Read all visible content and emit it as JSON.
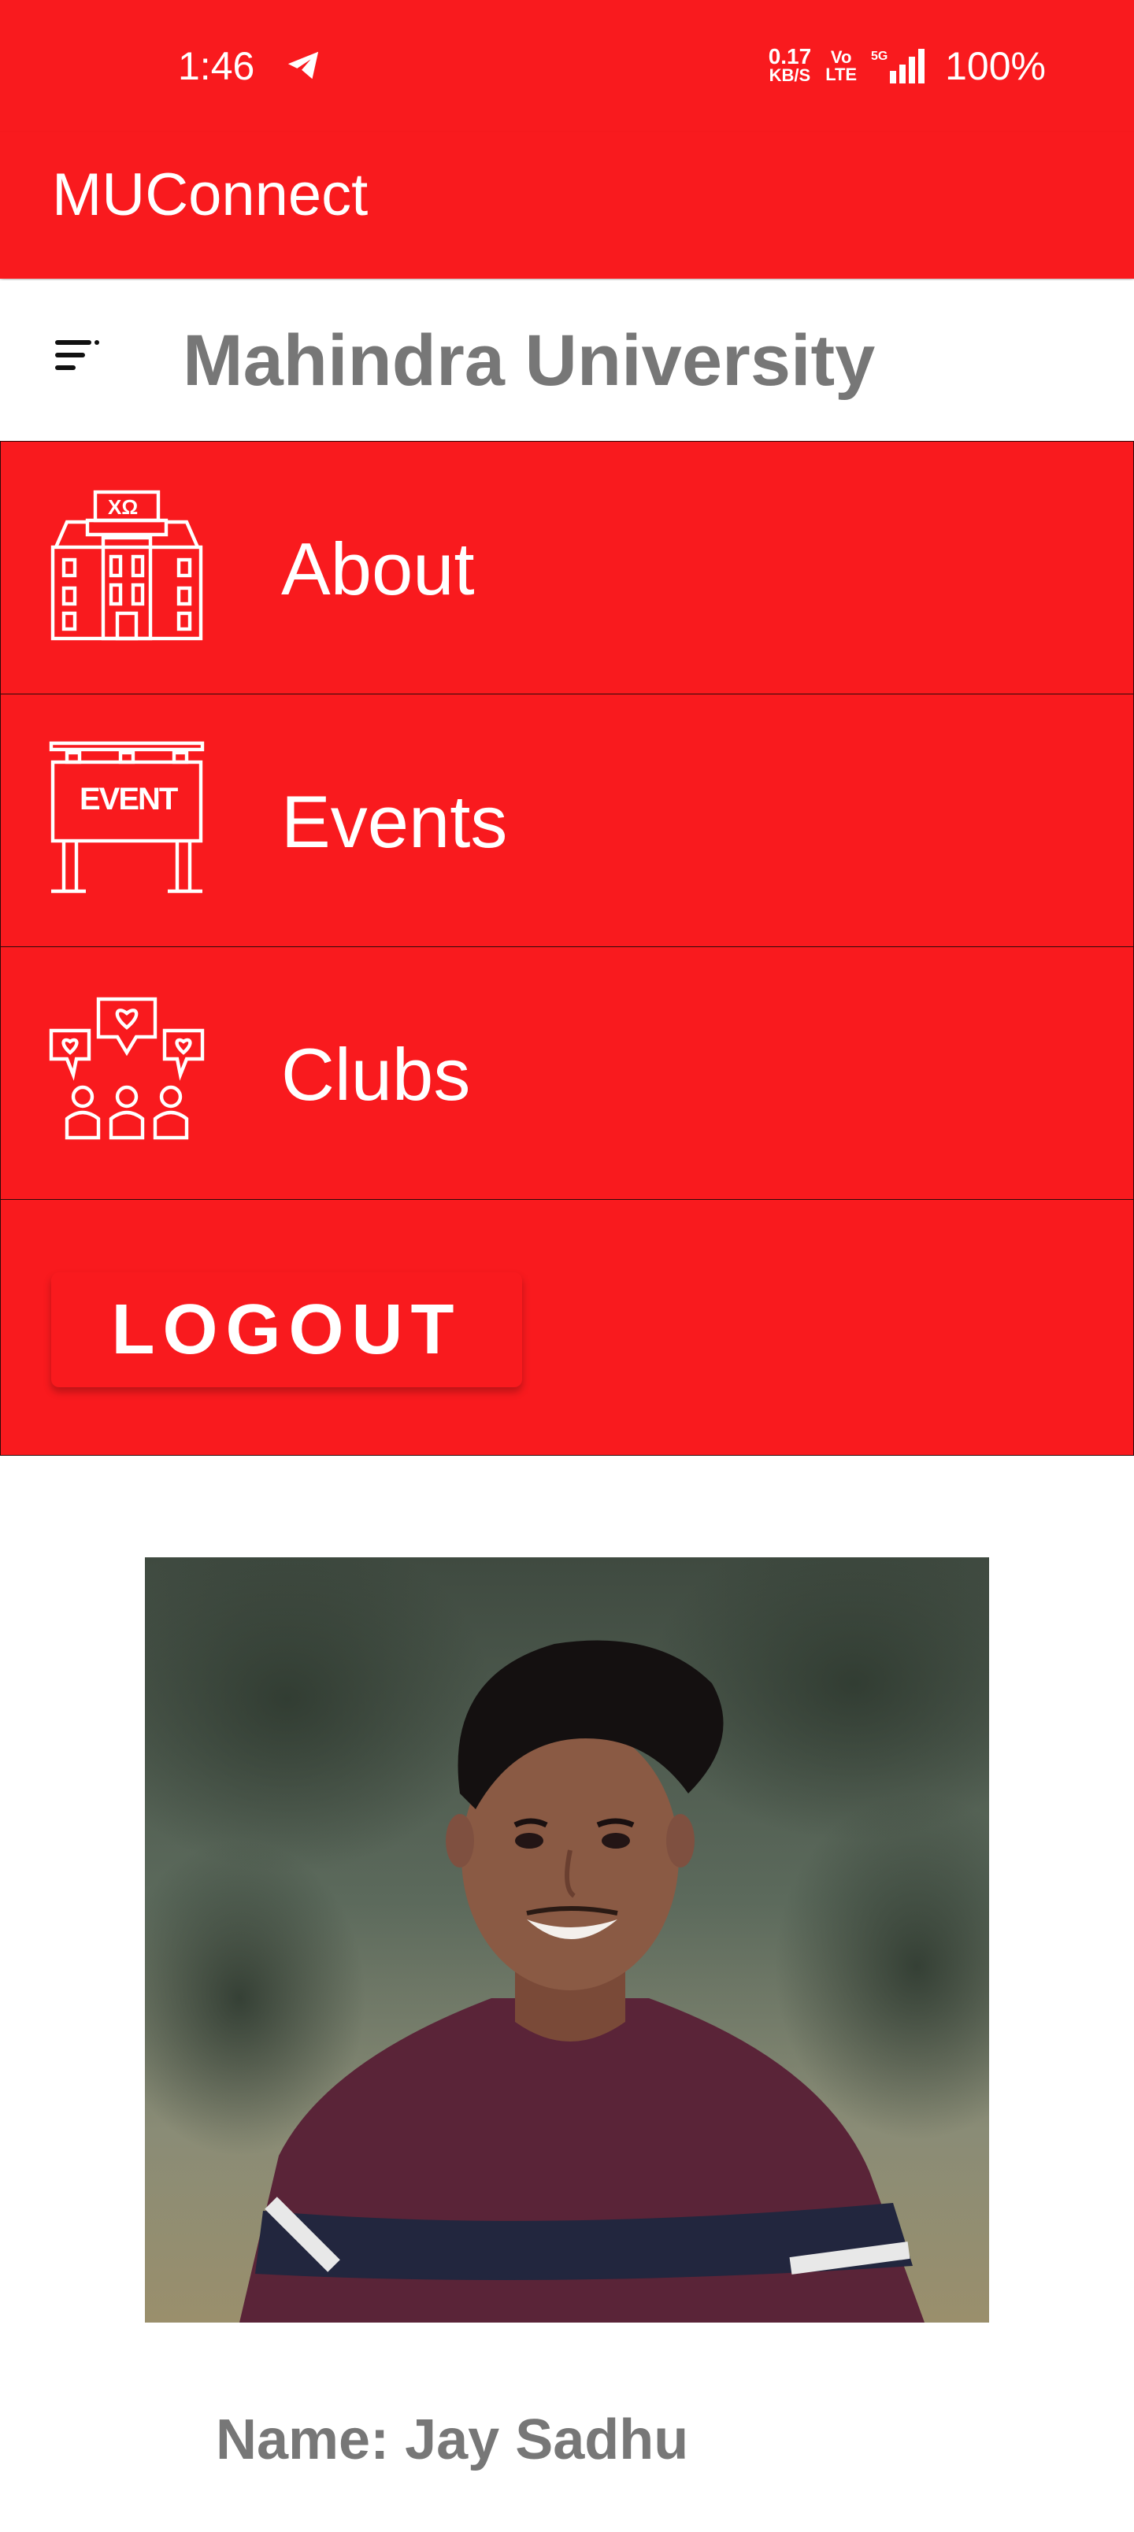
{
  "status_bar": {
    "time": "1:46",
    "net_speed_value": "0.17",
    "net_speed_unit": "KB/S",
    "volte_top": "Vo",
    "volte_bottom": "LTE",
    "network_type": "5G",
    "battery": "100%"
  },
  "app_bar": {
    "title": "MUConnect"
  },
  "header": {
    "title": "Mahindra University",
    "menu_icon": "sort-menu-icon"
  },
  "menu": {
    "items": [
      {
        "label": "About",
        "icon": "university-building-icon"
      },
      {
        "label": "Events",
        "icon": "event-board-icon",
        "icon_text": "EVENT"
      },
      {
        "label": "Clubs",
        "icon": "community-chat-icon"
      }
    ],
    "logout_label": "LOGOUT"
  },
  "profile": {
    "name": "Name: Jay Sadhu"
  },
  "colors": {
    "accent": "#f91a1e",
    "header_text": "#777777",
    "white": "#ffffff"
  }
}
